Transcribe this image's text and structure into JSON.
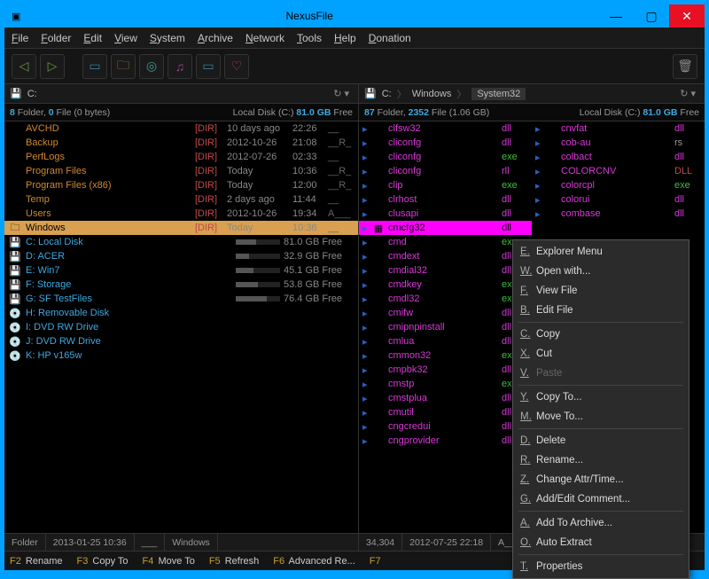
{
  "title": "NexusFile",
  "menu": [
    "File",
    "Folder",
    "Edit",
    "View",
    "System",
    "Archive",
    "Network",
    "Tools",
    "Help",
    "Donation"
  ],
  "leftPane": {
    "breadcrumb": [
      "C:"
    ],
    "summary": {
      "folders": "8",
      "files": "0",
      "size": "0 bytes",
      "disk": "Local Disk (C:)",
      "free": "81.0 GB",
      "freeLabel": "Free"
    },
    "rows": [
      {
        "t": "f",
        "n": "AVCHD",
        "dir": "[DIR]",
        "d": "10 days ago",
        "tm": "22:26",
        "a": "__"
      },
      {
        "t": "f",
        "n": "Backup",
        "dir": "[DIR]",
        "d": "2012-10-26",
        "tm": "21:08",
        "a": "__R_"
      },
      {
        "t": "f",
        "n": "PerfLogs",
        "dir": "[DIR]",
        "d": "2012-07-26",
        "tm": "02:33",
        "a": "__"
      },
      {
        "t": "f",
        "n": "Program Files",
        "dir": "[DIR]",
        "d": "Today",
        "tm": "10:36",
        "a": "__R_"
      },
      {
        "t": "f",
        "n": "Program Files (x86)",
        "dir": "[DIR]",
        "d": "Today",
        "tm": "12:00",
        "a": "__R_"
      },
      {
        "t": "f",
        "n": "Temp",
        "dir": "[DIR]",
        "d": "2 days ago",
        "tm": "11:44",
        "a": "__"
      },
      {
        "t": "f",
        "n": "Users",
        "dir": "[DIR]",
        "d": "2012-10-26",
        "tm": "19:34",
        "a": "A___"
      },
      {
        "t": "fs",
        "n": "Windows",
        "dir": "[DIR]",
        "d": "Today",
        "tm": "10:36",
        "a": "__"
      },
      {
        "t": "d",
        "n": "C: Local Disk",
        "free": "81.0 GB Free",
        "pct": 45
      },
      {
        "t": "d",
        "n": "D: ACER",
        "free": "32.9 GB Free",
        "pct": 30
      },
      {
        "t": "d",
        "n": "E: Win7",
        "free": "45.1 GB Free",
        "pct": 40
      },
      {
        "t": "d",
        "n": "F: Storage",
        "free": "53.8 GB Free",
        "pct": 50
      },
      {
        "t": "d",
        "n": "G: SF TestFiles",
        "free": "76.4 GB Free",
        "pct": 70
      },
      {
        "t": "dr",
        "n": "H: Removable Disk"
      },
      {
        "t": "dr",
        "n": "I:  DVD RW Drive"
      },
      {
        "t": "dr",
        "n": "J:  DVD RW Drive"
      },
      {
        "t": "dr",
        "n": "K: HP v165w"
      }
    ]
  },
  "rightPane": {
    "breadcrumb": [
      "C:",
      "Windows",
      "System32"
    ],
    "summary": {
      "folders": "87",
      "files": "2352",
      "size": "1.06 GB",
      "disk": "Local Disk (C:)",
      "free": "81.0 GB",
      "freeLabel": "Free"
    },
    "col1": [
      {
        "n": "clfsw32",
        "e": "dll"
      },
      {
        "n": "cliconfg",
        "e": "dll"
      },
      {
        "n": "cliconfg",
        "e": "exe"
      },
      {
        "n": "cliconfg",
        "e": "rll"
      },
      {
        "n": "clip",
        "e": "exe"
      },
      {
        "n": "clrhost",
        "e": "dll"
      },
      {
        "n": "clusapi",
        "e": "dll"
      },
      {
        "n": "cmcfg32",
        "e": "dll",
        "sel": true
      },
      {
        "n": "cmd",
        "e": "exe"
      },
      {
        "n": "cmdext",
        "e": "dll"
      },
      {
        "n": "cmdial32",
        "e": "dll"
      },
      {
        "n": "cmdkey",
        "e": "exe"
      },
      {
        "n": "cmdl32",
        "e": "exe"
      },
      {
        "n": "cmifw",
        "e": "dll"
      },
      {
        "n": "cmipnpinstall",
        "e": "dll"
      },
      {
        "n": "cmlua",
        "e": "dll"
      },
      {
        "n": "cmmon32",
        "e": "exe"
      },
      {
        "n": "cmpbk32",
        "e": "dll"
      },
      {
        "n": "cmstp",
        "e": "exe"
      },
      {
        "n": "cmstplua",
        "e": "dll"
      },
      {
        "n": "cmutil",
        "e": "dll"
      },
      {
        "n": "cngcredui",
        "e": "dll"
      },
      {
        "n": "cngprovider",
        "e": "dll"
      }
    ],
    "col2": [
      {
        "n": "cnvfat",
        "e": "dll"
      },
      {
        "n": "cob-au",
        "e": "rs"
      },
      {
        "n": "colbact",
        "e": "dll"
      },
      {
        "n": "COLORCNV",
        "e": "DLL"
      },
      {
        "n": "colorcpl",
        "e": "exe"
      },
      {
        "n": "colorui",
        "e": "dll"
      },
      {
        "n": "combase",
        "e": "dll"
      }
    ]
  },
  "ctx": [
    {
      "k": "E",
      "l": "Explorer Menu"
    },
    {
      "k": "W",
      "l": "Open with..."
    },
    {
      "k": "F",
      "l": "View File"
    },
    {
      "k": "B",
      "l": "Edit File"
    },
    "-",
    {
      "k": "C",
      "l": "Copy"
    },
    {
      "k": "X",
      "l": "Cut"
    },
    {
      "k": "V",
      "l": "Paste",
      "d": true
    },
    "-",
    {
      "k": "Y",
      "l": "Copy To..."
    },
    {
      "k": "M",
      "l": "Move To..."
    },
    "-",
    {
      "k": "D",
      "l": "Delete"
    },
    {
      "k": "R",
      "l": "Rename..."
    },
    {
      "k": "Z",
      "l": "Change Attr/Time..."
    },
    {
      "k": "G",
      "l": "Add/Edit Comment..."
    },
    "-",
    {
      "k": "A",
      "l": "Add To Archive..."
    },
    {
      "k": "O",
      "l": "Auto Extract"
    },
    "-",
    {
      "k": "T",
      "l": "Properties"
    }
  ],
  "statusLeft": {
    "a": "Folder",
    "b": "2013-01-25 10:36",
    "c": "___",
    "d": "Windows"
  },
  "statusRight": {
    "a": "34,304",
    "b": "2012-07-25 22:18",
    "c": "A__"
  },
  "fn": [
    {
      "k": "F2",
      "l": "Rename"
    },
    {
      "k": "F3",
      "l": "Copy To"
    },
    {
      "k": "F4",
      "l": "Move To"
    },
    {
      "k": "F5",
      "l": "Refresh"
    },
    {
      "k": "F6",
      "l": "Advanced Re..."
    },
    {
      "k": "F7",
      "l": ""
    }
  ]
}
